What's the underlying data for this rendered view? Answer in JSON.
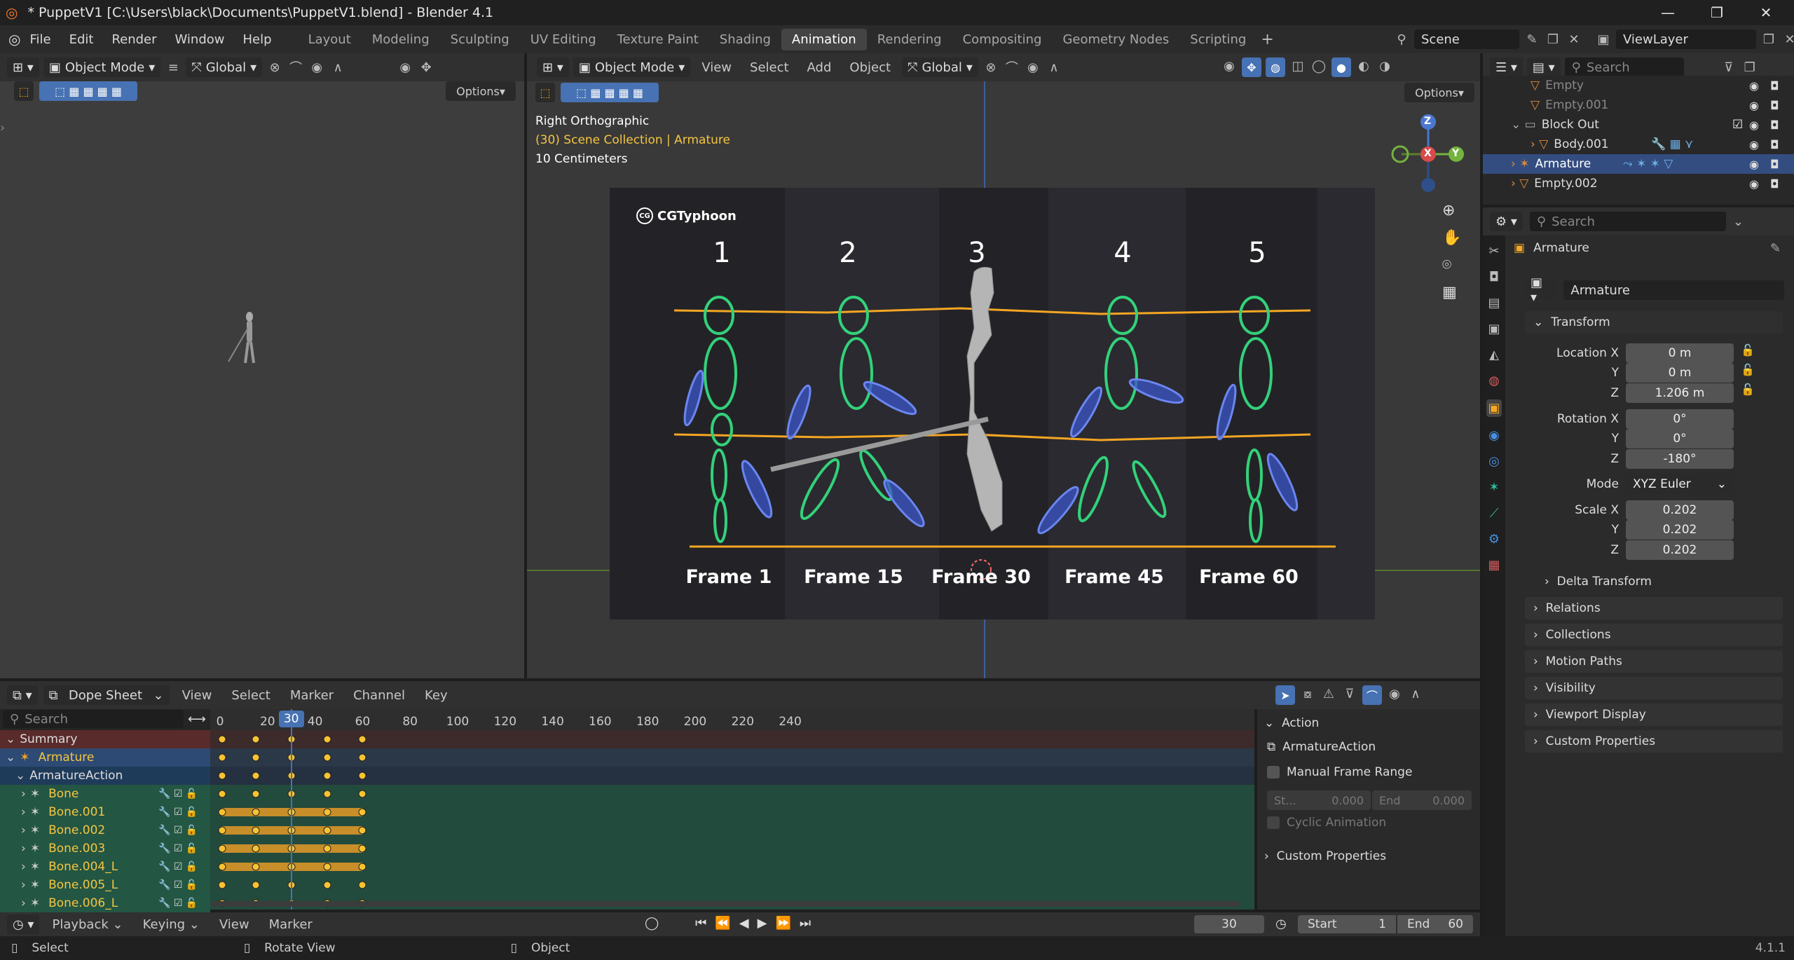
{
  "window": {
    "title": "* PuppetV1 [C:\\Users\\black\\Documents\\PuppetV1.blend] - Blender 4.1",
    "min": "—",
    "max": "❐",
    "close": "✕"
  },
  "menubar": {
    "items": [
      "File",
      "Edit",
      "Render",
      "Window",
      "Help"
    ]
  },
  "workspaces": [
    "Layout",
    "Modeling",
    "Sculpting",
    "UV Editing",
    "Texture Paint",
    "Shading",
    "Animation",
    "Rendering",
    "Compositing",
    "Geometry Nodes",
    "Scripting"
  ],
  "active_workspace": "Animation",
  "scene": {
    "name": "Scene",
    "view_layer": "ViewLayer"
  },
  "left_viewport": {
    "mode": "Object Mode",
    "orientation": "Global",
    "options": "Options"
  },
  "main_viewport": {
    "mode": "Object Mode",
    "menus": [
      "View",
      "Select",
      "Add",
      "Object"
    ],
    "orientation": "Global",
    "options": "Options",
    "overlay_line1": "Right Orthographic",
    "overlay_line2": "(30) Scene Collection | Armature",
    "overlay_line3": "10 Centimeters",
    "gizmo": {
      "z": "Z",
      "x": "X",
      "y": "Y"
    }
  },
  "reference_image": {
    "brand": "CGTyphoon",
    "numbers": [
      "1",
      "2",
      "3",
      "4",
      "5"
    ],
    "labels": [
      "Frame 1",
      "Frame 15",
      "Frame 30",
      "Frame 45",
      "Frame 60"
    ]
  },
  "outliner": {
    "search_placeholder": "Search",
    "rows": [
      {
        "name": "Empty",
        "indent": 2
      },
      {
        "name": "Empty.001",
        "indent": 2
      },
      {
        "name": "Block Out",
        "indent": 1
      },
      {
        "name": "Body.001",
        "indent": 2
      },
      {
        "name": "Armature",
        "indent": 1,
        "selected": true
      },
      {
        "name": "Empty.002",
        "indent": 1
      }
    ]
  },
  "properties": {
    "search_placeholder": "Search",
    "object_name": "Armature",
    "data_name": "Armature",
    "transform_title": "Transform",
    "location_label": "Location X",
    "rotation_label": "Rotation X",
    "scale_label": "Scale X",
    "y_label": "Y",
    "z_label": "Z",
    "location": [
      "0 m",
      "0 m",
      "1.206 m"
    ],
    "rotation": [
      "0°",
      "0°",
      "-180°"
    ],
    "mode_label": "Mode",
    "mode_value": "XYZ Euler",
    "scale": [
      "0.202",
      "0.202",
      "0.202"
    ],
    "delta": "Delta Transform",
    "panels": [
      "Relations",
      "Collections",
      "Motion Paths",
      "Visibility",
      "Viewport Display",
      "Custom Properties"
    ]
  },
  "dopesheet": {
    "editor": "Dope Sheet",
    "menus": [
      "View",
      "Select",
      "Marker",
      "Channel",
      "Key"
    ],
    "search_placeholder": "Search",
    "current_frame": "30",
    "ticks": [
      "0",
      "20",
      "40",
      "60",
      "80",
      "100",
      "120",
      "140",
      "160",
      "180",
      "200",
      "220",
      "240"
    ],
    "channels": [
      "Summary",
      "Armature",
      "ArmatureAction",
      "Bone",
      "Bone.001",
      "Bone.002",
      "Bone.003",
      "Bone.004_L",
      "Bone.005_L",
      "Bone.006_L"
    ],
    "keyframes": [
      1,
      15,
      30,
      45,
      60
    ]
  },
  "action_panel": {
    "header": "Action",
    "action_name": "ArmatureAction",
    "manual_range": "Manual Frame Range",
    "start_label": "St...",
    "start_value": "0.000",
    "end_label": "End",
    "end_value": "0.000",
    "cyclic": "Cyclic Animation",
    "custom": "Custom Properties"
  },
  "timeline": {
    "menus": [
      "Playback",
      "Keying",
      "View",
      "Marker"
    ],
    "frame": "30",
    "start_label": "Start",
    "start": "1",
    "end_label": "End",
    "end": "60"
  },
  "statusbar": {
    "select": "Select",
    "rotate": "Rotate View",
    "object": "Object",
    "version": "4.1.1"
  },
  "colors": {
    "accent": "#4772b3",
    "orange": "#f5a623",
    "green_bone": "#33d17a",
    "blue_bone": "#4a6ae0"
  }
}
